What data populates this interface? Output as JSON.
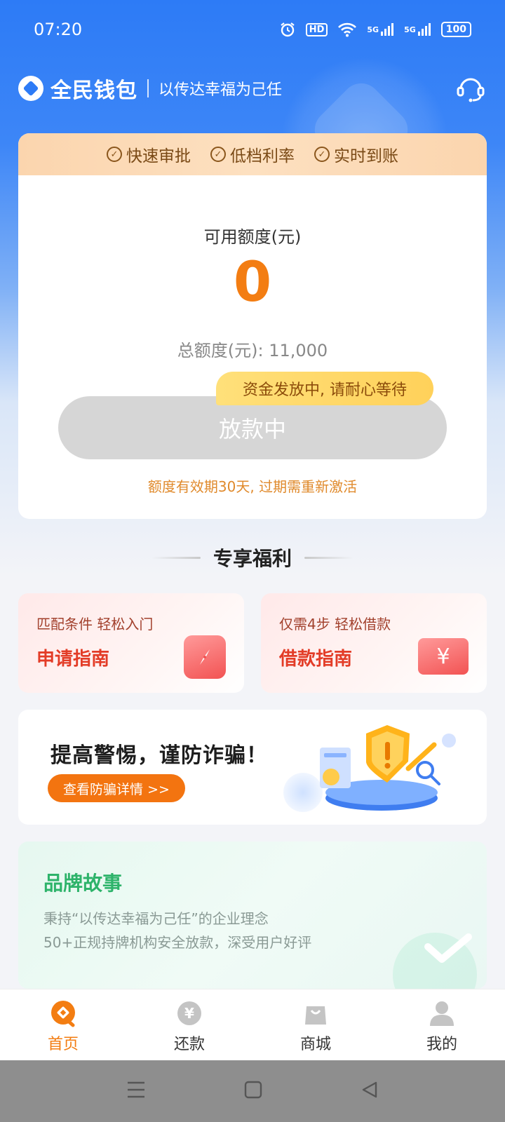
{
  "status_bar": {
    "time": "07:20",
    "hd": "HD",
    "net1": "5G",
    "net2": "5G",
    "battery": "100"
  },
  "header": {
    "app_name": "全民钱包",
    "slogan": "以传达幸福为己任"
  },
  "features": [
    "快速审批",
    "低档利率",
    "实时到账"
  ],
  "credit": {
    "available_label": "可用额度(元)",
    "available_amount": "0",
    "total_line": "总额度(元): 11,000",
    "tooltip": "资金发放中, 请耐心等待",
    "button_label": "放款中",
    "validity_note": "额度有效期30天, 过期需重新激活"
  },
  "exclusive": {
    "title": "专享福利",
    "cards": [
      {
        "subtitle": "匹配条件  轻松入门",
        "title": "申请指南"
      },
      {
        "subtitle": "仅需4步  轻松借款",
        "title": "借款指南"
      }
    ]
  },
  "fraud_banner": {
    "title": "提高警惕，谨防诈骗！",
    "button": "查看防骗详情 >>"
  },
  "brand_story": {
    "title": "品牌故事",
    "line1": "秉持“以传达幸福为己任”的企业理念",
    "line2": "50+正规持牌机构安全放款，深受用户好评"
  },
  "bottom_nav": [
    {
      "label": "首页",
      "icon": "home-icon",
      "active": true
    },
    {
      "label": "还款",
      "icon": "repay-icon",
      "active": false
    },
    {
      "label": "商城",
      "icon": "shop-bag-icon",
      "active": false
    },
    {
      "label": "我的",
      "icon": "profile-icon",
      "active": false
    }
  ],
  "colors": {
    "brand_blue": "#2d7bf6",
    "accent_orange": "#f37d12",
    "feature_band": "#fbd5ae",
    "button_disabled": "#d6d6d6",
    "benefit_red": "#e33c27",
    "brand_green": "#2db36a"
  }
}
